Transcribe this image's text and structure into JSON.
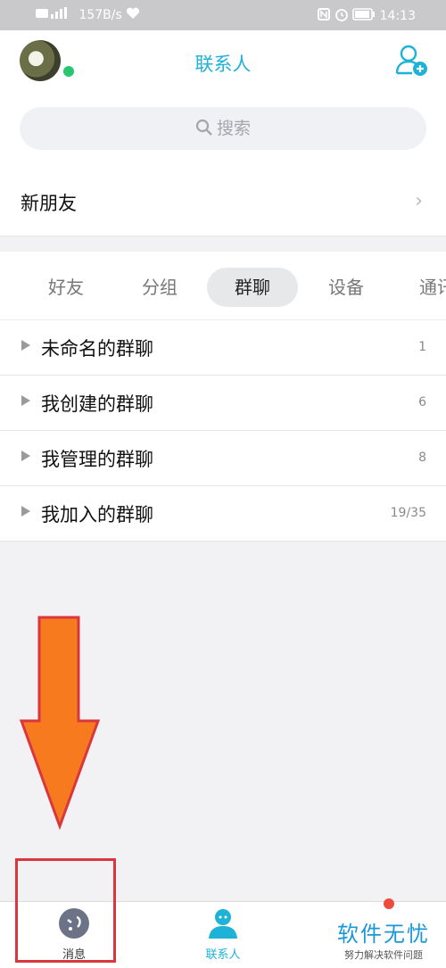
{
  "status_bar": {
    "left_text": "157B/s",
    "time": "14:13"
  },
  "header": {
    "title": "联系人",
    "add_contact_icon": "add-contact-icon",
    "accent_color": "#1db2d6"
  },
  "search": {
    "placeholder": "搜索"
  },
  "new_friends": {
    "label": "新朋友",
    "chevron": "›"
  },
  "tabs": [
    {
      "label": "好友",
      "active": false
    },
    {
      "label": "分组",
      "active": false
    },
    {
      "label": "群聊",
      "active": true
    },
    {
      "label": "设备",
      "active": false
    },
    {
      "label": "通讯录",
      "active": false
    }
  ],
  "groups": [
    {
      "name": "未命名的群聊",
      "count": "1"
    },
    {
      "name": "我创建的群聊",
      "count": "6"
    },
    {
      "name": "我管理的群聊",
      "count": "8"
    },
    {
      "name": "我加入的群聊",
      "count": "19/35"
    }
  ],
  "annotation": {
    "arrow_color": "#f77b1e",
    "box_color": "#d9363e"
  },
  "bottom_nav": {
    "items": [
      {
        "label": "消息",
        "icon": "message-icon"
      },
      {
        "label": "联系人",
        "icon": "contacts-icon"
      }
    ],
    "watermark_title": "软件无忧",
    "watermark_subtitle": "努力解决软件问题"
  }
}
